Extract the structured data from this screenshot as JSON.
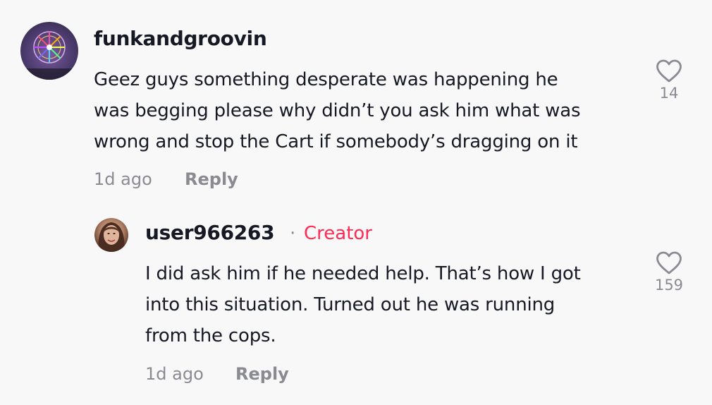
{
  "comments": [
    {
      "username": "funkandgroovin",
      "text_lines": [
        "Geez guys something desperate was happening he",
        "was begging please why didn’t you ask him what was",
        "wrong and stop the Cart if somebody’s dragging on it"
      ],
      "time": "1d ago",
      "reply_label": "Reply",
      "likes": "14",
      "avatar_icon": "ferris-wheel-avatar"
    },
    {
      "username": "user966263",
      "separator": "·",
      "badge": "Creator",
      "text_lines": [
        "I did ask him if he needed help. That’s how I got",
        "into this situation. Turned out he was running",
        "from the cops."
      ],
      "time": "1d ago",
      "reply_label": "Reply",
      "likes": "159",
      "avatar_icon": "person-photo-avatar"
    }
  ],
  "colors": {
    "background": "#f8f8f8",
    "text_primary": "#161823",
    "text_secondary": "#8a8b91",
    "creator_badge": "#fe2c55",
    "heart_outline": "#8a8b91"
  }
}
